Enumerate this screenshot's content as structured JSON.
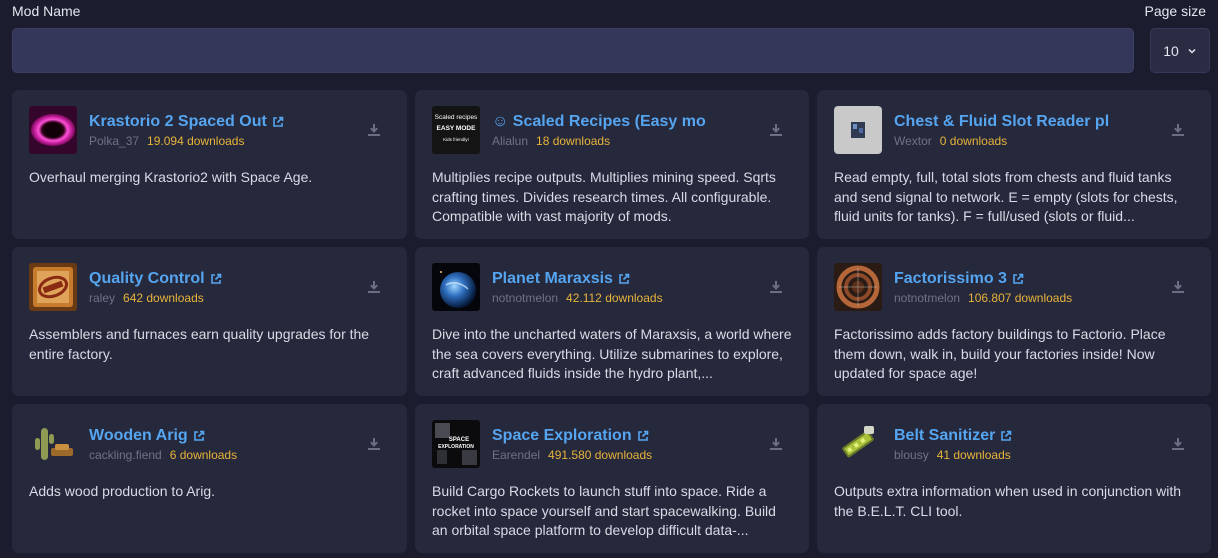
{
  "header": {
    "mod_name_label": "Mod Name",
    "page_size_label": "Page size"
  },
  "search": {
    "value": "",
    "placeholder": ""
  },
  "page_size": {
    "value": "10"
  },
  "mods": [
    {
      "title": "Krastorio 2 Spaced Out",
      "author": "Polka_37",
      "downloads": "19.094 downloads",
      "description": "Overhaul merging Krastorio2 with Space Age.",
      "icon": "krastorio-icon"
    },
    {
      "title": "☺ Scaled Recipes (Easy mo",
      "author": "Alialun",
      "downloads": "18 downloads",
      "description": "Multiplies recipe outputs. Multiplies mining speed. Sqrts crafting times. Divides research times. All configurable. Compatible with vast majority of mods.",
      "icon": "scaled-recipes-icon",
      "thumb_text": [
        "Scaled recipes",
        "EASY MODE",
        "Kids friendly!"
      ]
    },
    {
      "title": "Chest & Fluid Slot Reader pl",
      "author": "Wextor",
      "downloads": "0 downloads",
      "description": "Read empty, full, total slots from chests and fluid tanks and send signal to network. E = empty (slots for chests, fluid units for tanks). F = full/used (slots or fluid...",
      "icon": "chest-reader-icon"
    },
    {
      "title": "Quality Control",
      "author": "raley",
      "downloads": "642 downloads",
      "description": "Assemblers and furnaces earn quality upgrades for the entire factory.",
      "icon": "quality-control-icon"
    },
    {
      "title": "Planet Maraxsis",
      "author": "notnotmelon",
      "downloads": "42.112 downloads",
      "description": "Dive into the uncharted waters of Maraxsis, a world where the sea covers everything. Utilize submarines to explore, craft advanced fluids inside the hydro plant,...",
      "icon": "planet-icon"
    },
    {
      "title": "Factorissimo 3",
      "author": "notnotmelon",
      "downloads": "106.807 downloads",
      "description": "Factorissimo adds factory buildings to Factorio. Place them down, walk in, build your factories inside! Now updated for space age!",
      "icon": "factorissimo-icon"
    },
    {
      "title": "Wooden Arig",
      "author": "cackling.fiend",
      "downloads": "6 downloads",
      "description": "Adds wood production to Arig.",
      "icon": "cactus-icon"
    },
    {
      "title": "Space Exploration",
      "author": "Earendel",
      "downloads": "491.580 downloads",
      "description": "Build Cargo Rockets to launch stuff into space. Ride a rocket into space yourself and start spacewalking. Build an orbital space platform to develop difficult data-...",
      "icon": "space-exploration-icon",
      "thumb_text": [
        "SPACE",
        "EXPLORATION"
      ]
    },
    {
      "title": "Belt Sanitizer",
      "author": "blousy",
      "downloads": "41 downloads",
      "description": "Outputs extra information when used in conjunction with the B.E.L.T. CLI tool.",
      "icon": "belt-sanitizer-icon"
    }
  ],
  "colors": {
    "background": "#1b1c2d",
    "card": "#26283c",
    "title": "#55a5f0",
    "downloads": "#e7b43a",
    "author": "#6f7288"
  }
}
